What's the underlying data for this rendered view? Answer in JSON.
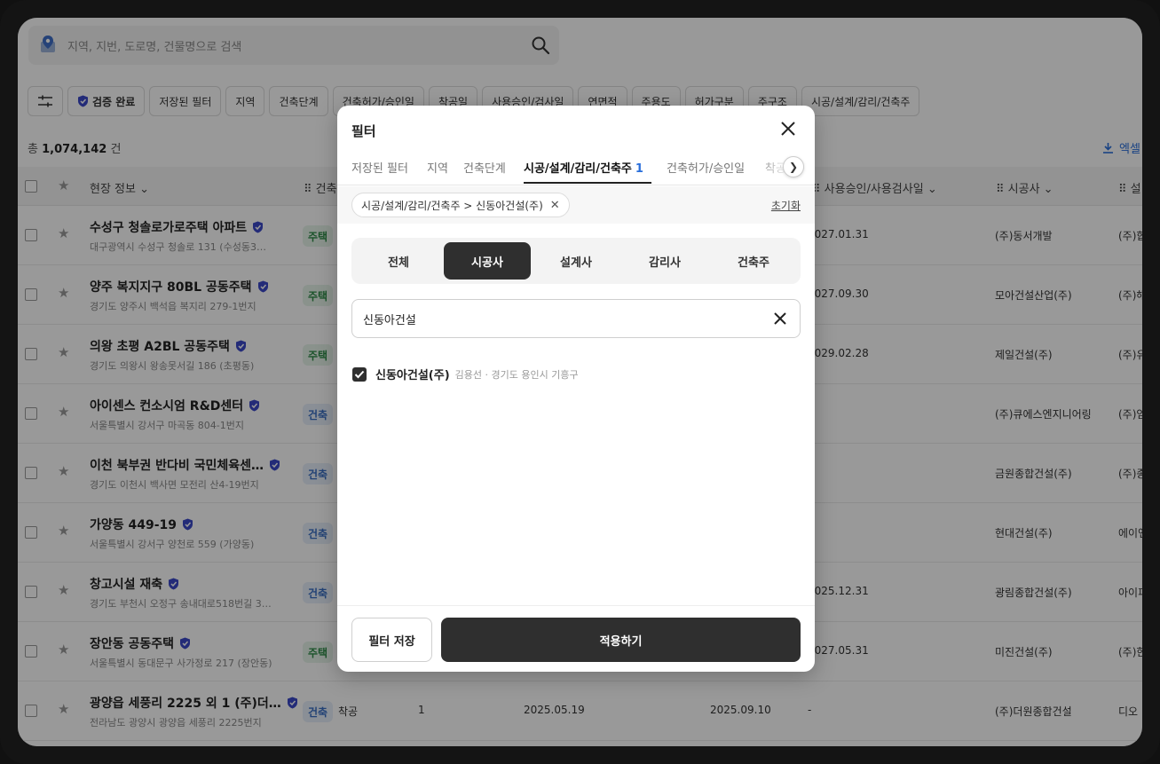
{
  "search": {
    "placeholder": "지역, 지번, 도로명, 건물명으로 검색"
  },
  "chips": {
    "verified": "검증 완료",
    "items": [
      "저장된 필터",
      "지역",
      "건축단계",
      "건축허가/승인일",
      "착공일",
      "사용승인/검사일",
      "연면적",
      "주용도",
      "허가구분",
      "주구조",
      "시공/설계/감리/건축주"
    ]
  },
  "total": {
    "prefix": "총",
    "count": "1,074,142",
    "suffix": "건"
  },
  "excel": {
    "label": "엑셀"
  },
  "table": {
    "headers": {
      "site_info": "현장 정보",
      "stage": "건축",
      "use_approval": "사용승인/사용검사일",
      "builder": "시공사",
      "designer": "설"
    },
    "rows": [
      {
        "name": "수성구 청솔로가로주택 아파트",
        "addr": "대구광역시 수성구 청솔로 131 (수성동3…",
        "tag": "주택",
        "tag_color": "green",
        "date": "2027.01.31",
        "builder": "(주)동서개발",
        "designer": "(주)합"
      },
      {
        "name": "양주 복지지구 80BL 공동주택",
        "addr": "경기도 양주시 백석읍 복지리 279-1번지",
        "tag": "주택",
        "tag_color": "green",
        "date": "2027.09.30",
        "builder": "모아건설산업(주)",
        "designer": "(주)해"
      },
      {
        "name": "의왕 초평 A2BL 공동주택",
        "addr": "경기도 의왕시 왕송못서길 186 (초평동)",
        "tag": "주택",
        "tag_color": "green",
        "date": "2029.02.28",
        "builder": "제일건설(주)",
        "designer": "(주)유"
      },
      {
        "name": "아이센스 컨소시엄 R&D센터",
        "addr": "서울특별시 강서구 마곡동 804-1번지",
        "tag": "건축",
        "tag_color": "blue",
        "date": "",
        "builder": "(주)큐에스엔지니어링",
        "designer": "(주)엄"
      },
      {
        "name": "이천 북부권 반다비 국민체육센…",
        "addr": "경기도 이천시 백사면 모전리 산4-19번지",
        "tag": "건축",
        "tag_color": "blue",
        "date": "",
        "builder": "금원종합건설(주)",
        "designer": "(주)종"
      },
      {
        "name": "가양동 449-19",
        "addr": "서울특별시 강서구 양천로 559 (가양동)",
        "tag": "건축",
        "tag_color": "blue",
        "date": "",
        "builder": "현대건설(주)",
        "designer": "에이앤"
      },
      {
        "name": "창고시설 재축",
        "addr": "경기도 부천시 오정구 송내대로518번길 3…",
        "tag": "건축",
        "tag_color": "blue",
        "date": "2025.12.31",
        "builder": "광림종합건설(주)",
        "designer": "아이피"
      },
      {
        "name": "장안동 공동주택",
        "addr": "서울특별시 동대문구 사가정로 217 (장안동)",
        "tag": "주택",
        "tag_color": "green",
        "date": "2027.05.31",
        "builder": "미진건설(주)",
        "designer": "(주)한"
      },
      {
        "name": "광양읍 세풍리 2225 외 1 (주)더…",
        "addr": "전라남도 광양시 광양읍 세풍리 2225번지",
        "tag": "건축",
        "tag_color": "blue",
        "stage": "착공",
        "col_a": "1",
        "col_b": "2025.05.19",
        "col_c": "2025.09.10",
        "date": "-",
        "builder": "(주)더원종합건설",
        "designer": "디오"
      }
    ]
  },
  "modal": {
    "title": "필터",
    "tabs": [
      {
        "label": "저장된 필터"
      },
      {
        "label": "지역"
      },
      {
        "label": "건축단계"
      },
      {
        "label": "시공/설계/감리/건축주",
        "count": "1"
      },
      {
        "label": "건축허가/승인일"
      },
      {
        "label": "착공"
      }
    ],
    "selected_chip": "시공/설계/감리/건축주 > 신동아건설(주)",
    "reset_label": "초기화",
    "segments": [
      "전체",
      "시공사",
      "설계사",
      "감리사",
      "건축주"
    ],
    "active_segment": "시공사",
    "search_value": "신동아건설",
    "result": {
      "name": "신동아건설(주)",
      "meta": "김용선 · 경기도 용인시 기흥구",
      "checked": true
    },
    "save_label": "필터 저장",
    "apply_label": "적용하기"
  },
  "colors": {
    "accent": "#2a6fdb",
    "dark": "#2f2f2f",
    "overlay": "rgba(0,0,0,0.40)"
  }
}
